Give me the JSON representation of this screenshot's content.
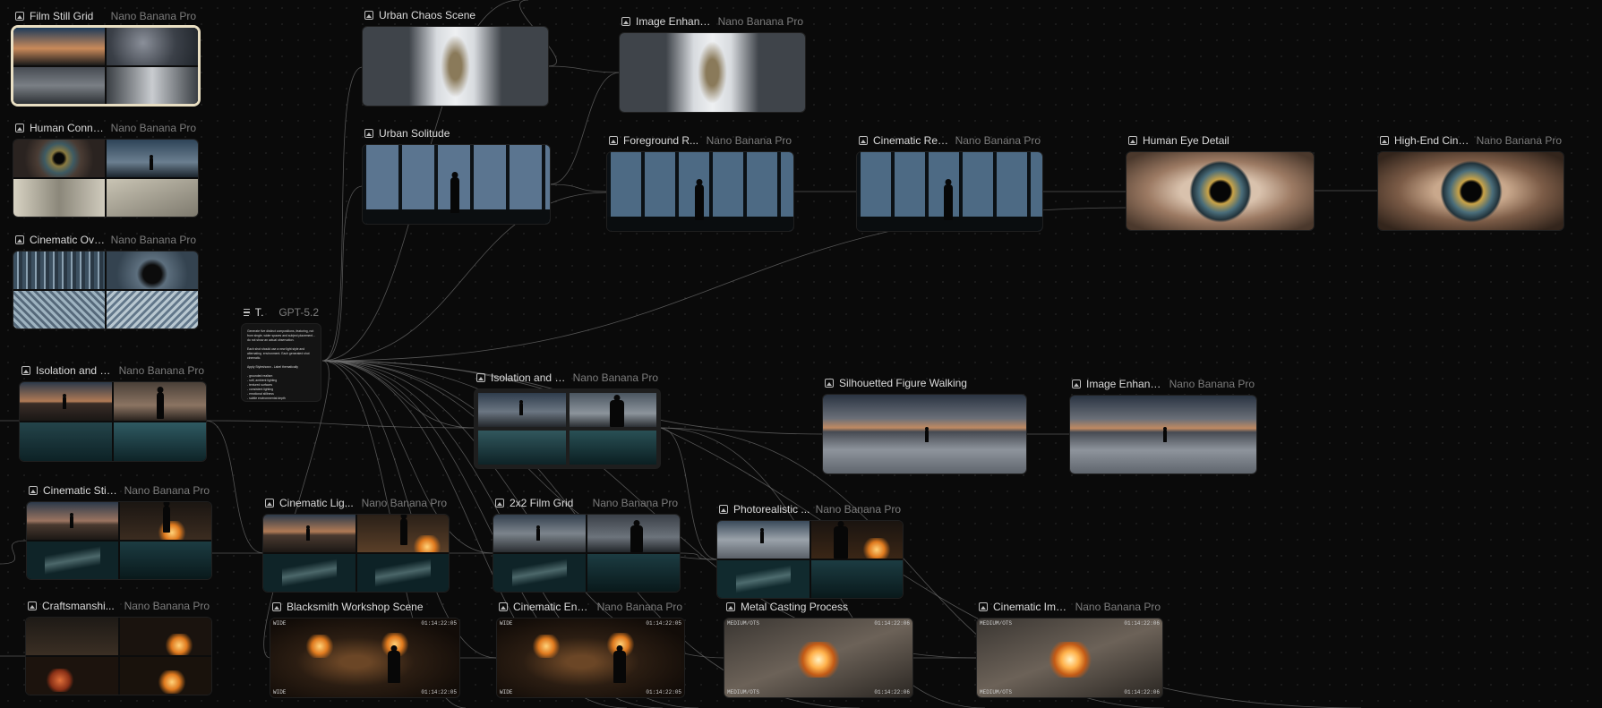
{
  "canvas": {
    "background": "#0a0a0a",
    "wire_color": "#6e6e6e",
    "selection_color": "#e9dfc3"
  },
  "nodes": [
    {
      "id": "film-still-grid",
      "title": "Film Still Grid",
      "model": "Nano Banana Pro",
      "icon": "image-icon",
      "selected": true
    },
    {
      "id": "human-connection",
      "title": "Human Conne...",
      "model": "Nano Banana Pro",
      "icon": "image-icon"
    },
    {
      "id": "cinematic-overview",
      "title": "Cinematic Ove...",
      "model": "Nano Banana Pro",
      "icon": "image-icon"
    },
    {
      "id": "urban-chaos-scene",
      "title": "Urban Chaos Scene",
      "model": "",
      "icon": "image-icon"
    },
    {
      "id": "urban-solitude",
      "title": "Urban Solitude",
      "model": "",
      "icon": "image-icon"
    },
    {
      "id": "image-enhance-1",
      "title": "Image Enhanc...",
      "model": "Nano Banana Pro",
      "icon": "image-icon"
    },
    {
      "id": "foreground-r",
      "title": "Foreground R...",
      "model": "Nano Banana Pro",
      "icon": "image-icon"
    },
    {
      "id": "cinematic-res",
      "title": "Cinematic Res...",
      "model": "Nano Banana Pro",
      "icon": "image-icon"
    },
    {
      "id": "human-eye-detail",
      "title": "Human Eye Detail",
      "model": "",
      "icon": "image-icon"
    },
    {
      "id": "high-end-cine",
      "title": "High-End Cine...",
      "model": "Nano Banana Pro",
      "icon": "image-icon"
    },
    {
      "id": "text-prompt",
      "title": "T...",
      "model": "GPT-5.2",
      "icon": "text-icon"
    },
    {
      "id": "isolation-1",
      "title": "Isolation and L...",
      "model": "Nano Banana Pro",
      "icon": "image-icon"
    },
    {
      "id": "isolation-2",
      "title": "Isolation and L...",
      "model": "Nano Banana Pro",
      "icon": "image-icon"
    },
    {
      "id": "silhouetted-figure",
      "title": "Silhouetted Figure Walking",
      "model": "",
      "icon": "image-icon"
    },
    {
      "id": "image-enhance-2",
      "title": "Image Enhanc...",
      "model": "Nano Banana Pro",
      "icon": "image-icon"
    },
    {
      "id": "cinematic-still",
      "title": "Cinematic Still...",
      "model": "Nano Banana Pro",
      "icon": "image-icon"
    },
    {
      "id": "cinematic-lig",
      "title": "Cinematic Lig...",
      "model": "Nano Banana Pro",
      "icon": "image-icon"
    },
    {
      "id": "film-grid-2x2",
      "title": "2x2 Film Grid",
      "model": "Nano Banana Pro",
      "icon": "image-icon"
    },
    {
      "id": "photorealistic",
      "title": "Photorealistic ...",
      "model": "Nano Banana Pro",
      "icon": "image-icon"
    },
    {
      "id": "craftsmanship",
      "title": "Craftsmanshi...",
      "model": "Nano Banana Pro",
      "icon": "image-icon"
    },
    {
      "id": "blacksmith-workshop",
      "title": "Blacksmith Workshop Scene",
      "model": "",
      "icon": "image-icon"
    },
    {
      "id": "cinematic-enh",
      "title": "Cinematic Enh...",
      "model": "Nano Banana Pro",
      "icon": "image-icon"
    },
    {
      "id": "metal-casting",
      "title": "Metal Casting Process",
      "model": "",
      "icon": "image-icon"
    },
    {
      "id": "cinematic-ima",
      "title": "Cinematic Ima...",
      "model": "Nano Banana Pro",
      "icon": "image-icon"
    }
  ],
  "timecodes": {
    "blacksmith": {
      "top_left": "WIDE",
      "top_right": "01:14:22:05",
      "bottom_left": "WIDE",
      "bottom_right": "01:14:22:05"
    },
    "cinematic_enh": {
      "top_left": "WIDE",
      "top_right": "01:14:22:05",
      "bottom_left": "WIDE",
      "bottom_right": "01:14:22:05"
    },
    "metal_casting": {
      "top_left": "MEDIUM/OTS",
      "top_right": "01:14:22:06",
      "bottom_left": "MEDIUM/OTS",
      "bottom_right": "01:14:22:06"
    },
    "cinematic_ima": {
      "top_left": "MEDIUM/OTS",
      "top_right": "01:14:22:06",
      "bottom_left": "MEDIUM/OTS",
      "bottom_right": "01:14:22:06"
    }
  },
  "text_prompt_body": "Generate five distinct compositions, featuring, not from single, wider spaces and subject placement... do not show an actual observation.\n\nEach shot should use a new light style and alternating  environment. Each generated shot cinematic.\n\nApply Styleshown - Label thematically\n\n- grounded realism\n- soft, ambient lighting\n- textured surfaces\n- consistent lighting\n- emotional stillness\n- subtle environmental depth\n\nKeep the same anchor and produce consistent final notes."
}
